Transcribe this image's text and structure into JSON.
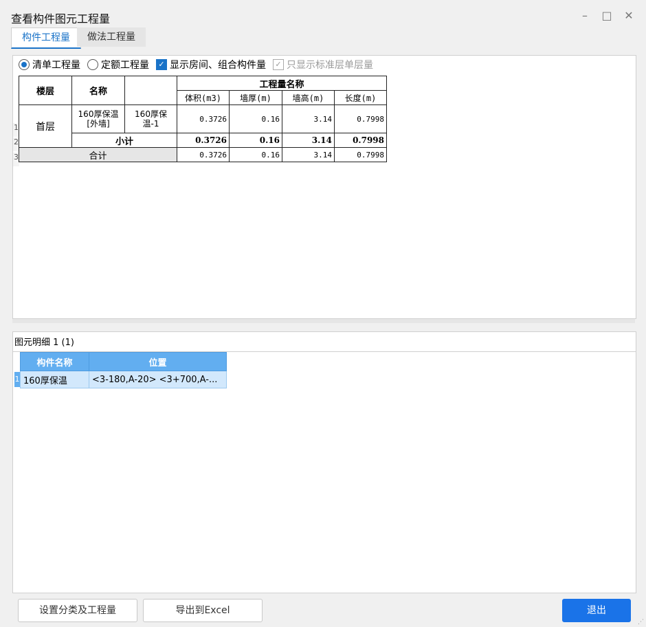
{
  "window": {
    "title": "查看构件图元工程量",
    "controls": {
      "minimize": "–",
      "maximize": "□",
      "close": "✕"
    }
  },
  "tabs": [
    {
      "label": "构件工程量",
      "active": true
    },
    {
      "label": "做法工程量",
      "active": false
    }
  ],
  "options": {
    "radio_list": "清单工程量",
    "radio_quota": "定额工程量",
    "chk_show_rooms": "显示房间、组合构件量",
    "chk_standard_floor": "只显示标准层单层量"
  },
  "quantity_table": {
    "header_floor": "楼层",
    "header_name": "名称",
    "header_group": "工程量名称",
    "columns": [
      "体积(m3)",
      "墙厚(m)",
      "墙高(m)",
      "长度(m)"
    ],
    "row_numbers": [
      "1",
      "2",
      "3"
    ],
    "floor": "首层",
    "component_name": "160厚保温[外墙]",
    "sub_name": "160厚保温-1",
    "row1_values": [
      "0.3726",
      "0.16",
      "3.14",
      "0.7998"
    ],
    "subtotal_label": "小计",
    "subtotal_values": [
      "0.3726",
      "0.16",
      "3.14",
      "0.7998"
    ],
    "total_label": "合计",
    "total_values": [
      "0.3726",
      "0.16",
      "3.14",
      "0.7998"
    ]
  },
  "detail": {
    "title": "图元明细  1 (1)",
    "columns": [
      "构件名称",
      "位置"
    ],
    "row_number": "1",
    "rows": [
      {
        "name": "160厚保温",
        "position": "<3-180,A-20> <3+700,A-..."
      }
    ]
  },
  "buttons": {
    "set_category": "设置分类及工程量",
    "export_excel": "导出到Excel",
    "exit": "退出"
  },
  "colors": {
    "accent": "#1a73e8",
    "header_blue": "#62aef0",
    "row_blue": "#d2e8fc"
  }
}
